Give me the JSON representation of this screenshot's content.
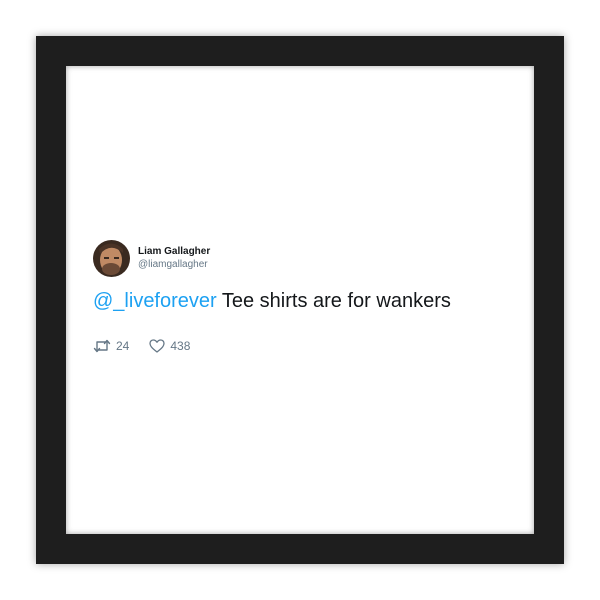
{
  "tweet": {
    "display_name": "Liam Gallagher",
    "handle": "@liamgallagher",
    "mention": "@_liveforever",
    "text": " Tee shirts are for wankers",
    "retweet_count": "24",
    "like_count": "438"
  },
  "icons": {
    "retweet": "retweet-icon",
    "like": "heart-icon"
  },
  "colors": {
    "frame": "#1e1e1e",
    "mention": "#1da1f2",
    "meta_text": "#657786",
    "text": "#14171a"
  }
}
